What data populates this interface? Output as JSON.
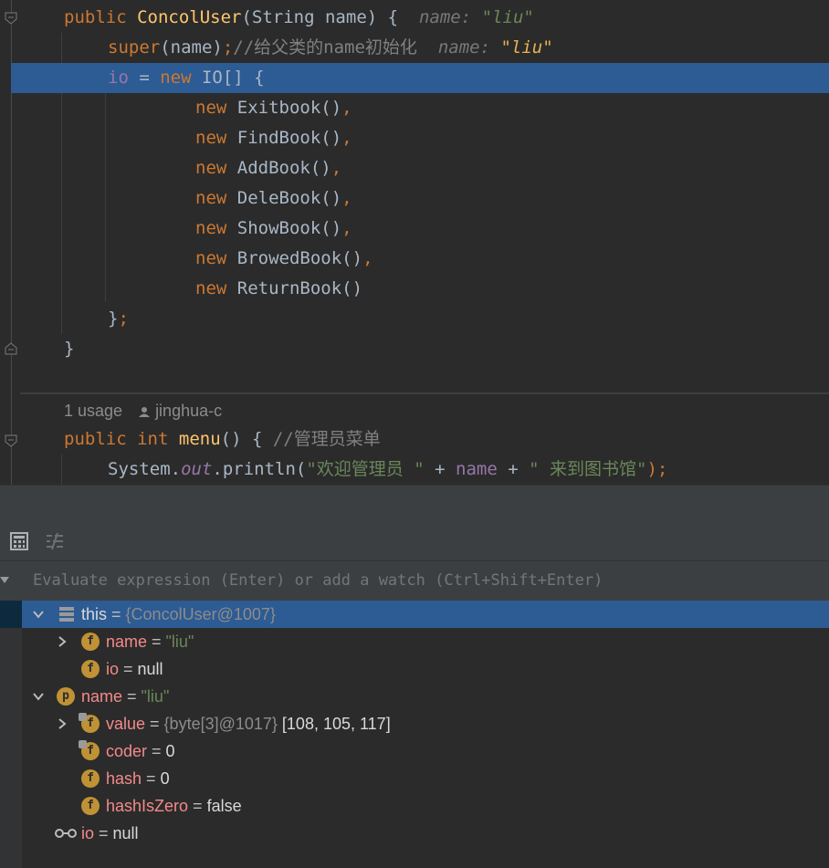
{
  "editor": {
    "line1": {
      "kw": "public",
      "name": "ConcolUser",
      "params": "(String name) {",
      "hint_label": "name:",
      "hint_value": "\"liu\""
    },
    "line2": {
      "kw": "super",
      "args": "(name)",
      "semi": ";",
      "comment": "//给父类的name初始化",
      "hint_label": "name:",
      "hint_value": "\"liu\""
    },
    "line3": {
      "field": "io",
      "eq": " = ",
      "kw": "new",
      "type": " IO[] {"
    },
    "array_items": [
      {
        "kw": "new",
        "ctor": "Exitbook()",
        "comma": ","
      },
      {
        "kw": "new",
        "ctor": "FindBook()",
        "comma": ","
      },
      {
        "kw": "new",
        "ctor": "AddBook()",
        "comma": ","
      },
      {
        "kw": "new",
        "ctor": "DeleBook()",
        "comma": ","
      },
      {
        "kw": "new",
        "ctor": "ShowBook()",
        "comma": ","
      },
      {
        "kw": "new",
        "ctor": "BrowedBook()",
        "comma": ","
      },
      {
        "kw": "new",
        "ctor": "ReturnBook()",
        "comma": ""
      }
    ],
    "close_array": "};",
    "close_brace_text": "}",
    "close_array_brace": "}",
    "close_array_semi": ";",
    "usage": "1 usage",
    "author": "jinghua-c",
    "menu_line": {
      "kw1": "public",
      "kw2": "int",
      "name": "menu",
      "rest": "() { ",
      "comment": "//管理员菜单"
    },
    "print_line": {
      "obj": "System.",
      "field": "out",
      "call": ".println(",
      "str1": "\"欢迎管理员 \"",
      "plus1": " + ",
      "var": "name",
      "plus2": " + ",
      "str2": "\" 来到图书馆\"",
      "end": ");"
    }
  },
  "eval": {
    "placeholder": "Evaluate expression (Enter) or add a watch (Ctrl+Shift+Enter)"
  },
  "vars": [
    {
      "name": "this",
      "eq": " = ",
      "value": "{ConcolUser@1007}"
    },
    {
      "name": "name",
      "eq": " = ",
      "value": "\"liu\""
    },
    {
      "name": "io",
      "eq": " = ",
      "value": "null"
    },
    {
      "name": "name",
      "eq": " = ",
      "value": "\"liu\""
    },
    {
      "name": "value",
      "eq": " = ",
      "value_obj": "{byte[3]@1017}",
      "value": " [108, 105, 117]"
    },
    {
      "name": "coder",
      "eq": " = ",
      "value": "0"
    },
    {
      "name": "hash",
      "eq": " = ",
      "value": "0"
    },
    {
      "name": "hashIsZero",
      "eq": " = ",
      "value": "false"
    },
    {
      "name": "io",
      "eq": " = ",
      "value": "null"
    }
  ],
  "badges": {
    "field": "f",
    "param": "p"
  },
  "icons": [
    "fold-icon",
    "calculator-icon",
    "format-icon",
    "expand-chevron-icon",
    "collapse-chevron-icon",
    "object-icon",
    "watch-glasses-icon",
    "person-icon"
  ]
}
